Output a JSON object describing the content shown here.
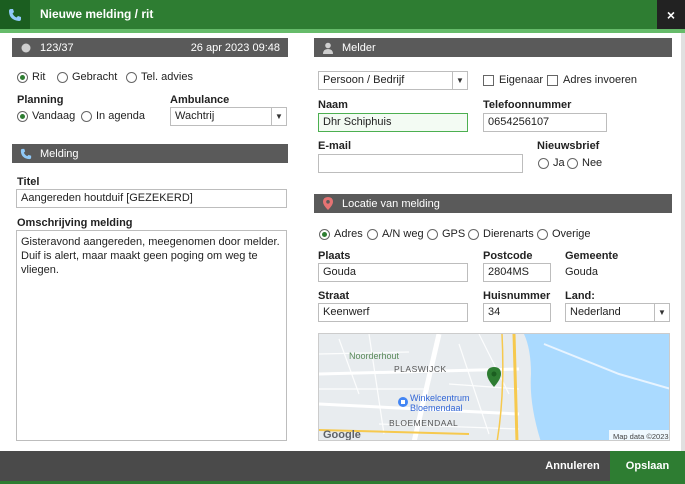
{
  "window": {
    "title": "Nieuwe melding / rit",
    "close_label": "×"
  },
  "left": {
    "header_id": "123/37",
    "header_date": "26 apr 2023 09:48",
    "type_options": [
      {
        "label": "Rit",
        "selected": true
      },
      {
        "label": "Gebracht",
        "selected": false
      },
      {
        "label": "Tel. advies",
        "selected": false
      }
    ],
    "planning_label": "Planning",
    "planning_options": [
      {
        "label": "Vandaag",
        "selected": true
      },
      {
        "label": "In agenda",
        "selected": false
      }
    ],
    "ambulance_label": "Ambulance",
    "ambulance_value": "Wachtrij",
    "melding_header": "Melding",
    "titel_label": "Titel",
    "titel_value": "Aangereden houtduif [GEZEKERD]",
    "omschrijving_label": "Omschrijving melding",
    "omschrijving_value": "Gisteravond aangereden, meegenomen door melder. Duif is alert, maar maakt geen poging om weg te vliegen."
  },
  "melder": {
    "header": "Melder",
    "type_value": "Persoon / Bedrijf",
    "eigenaar_label": "Eigenaar",
    "adres_invoeren_label": "Adres invoeren",
    "naam_label": "Naam",
    "naam_value": "Dhr Schiphuis",
    "telefoon_label": "Telefoonnummer",
    "telefoon_value": "0654256107",
    "email_label": "E-mail",
    "email_value": "",
    "nieuwsbrief_label": "Nieuwsbrief",
    "nieuwsbrief_options": [
      {
        "label": "Ja",
        "selected": false
      },
      {
        "label": "Nee",
        "selected": false
      }
    ]
  },
  "locatie": {
    "header": "Locatie van melding",
    "options": [
      {
        "label": "Adres",
        "selected": true
      },
      {
        "label": "A/N weg",
        "selected": false
      },
      {
        "label": "GPS",
        "selected": false
      },
      {
        "label": "Dierenarts",
        "selected": false
      },
      {
        "label": "Overige",
        "selected": false
      }
    ],
    "plaats_label": "Plaats",
    "plaats_value": "Gouda",
    "postcode_label": "Postcode",
    "postcode_value": "2804MS",
    "gemeente_label": "Gemeente",
    "gemeente_value": "Gouda",
    "straat_label": "Straat",
    "straat_value": "Keenwerf",
    "huisnummer_label": "Huisnummer",
    "huisnummer_value": "34",
    "land_label": "Land:",
    "land_value": "Nederland"
  },
  "map": {
    "label_noorderhout": "Noorderhout",
    "label_plaswijck": "PLASWIJCK",
    "label_winkelcentrum_1": "Winkelcentrum",
    "label_winkelcentrum_2": "Bloemendaal",
    "label_bloemendaal": "BLOEMENDAAL",
    "google_logo": "Google",
    "attribution": "Map data ©2023",
    "colors": {
      "water": "#aadaff",
      "land": "#e8ecef",
      "road": "#f6c94e",
      "pin": "#2e7d32"
    }
  },
  "footer": {
    "cancel_label": "Annuleren",
    "save_label": "Opslaan"
  },
  "colors": {
    "primary": "#2e7d32",
    "header_gray": "#5a5a5a"
  }
}
